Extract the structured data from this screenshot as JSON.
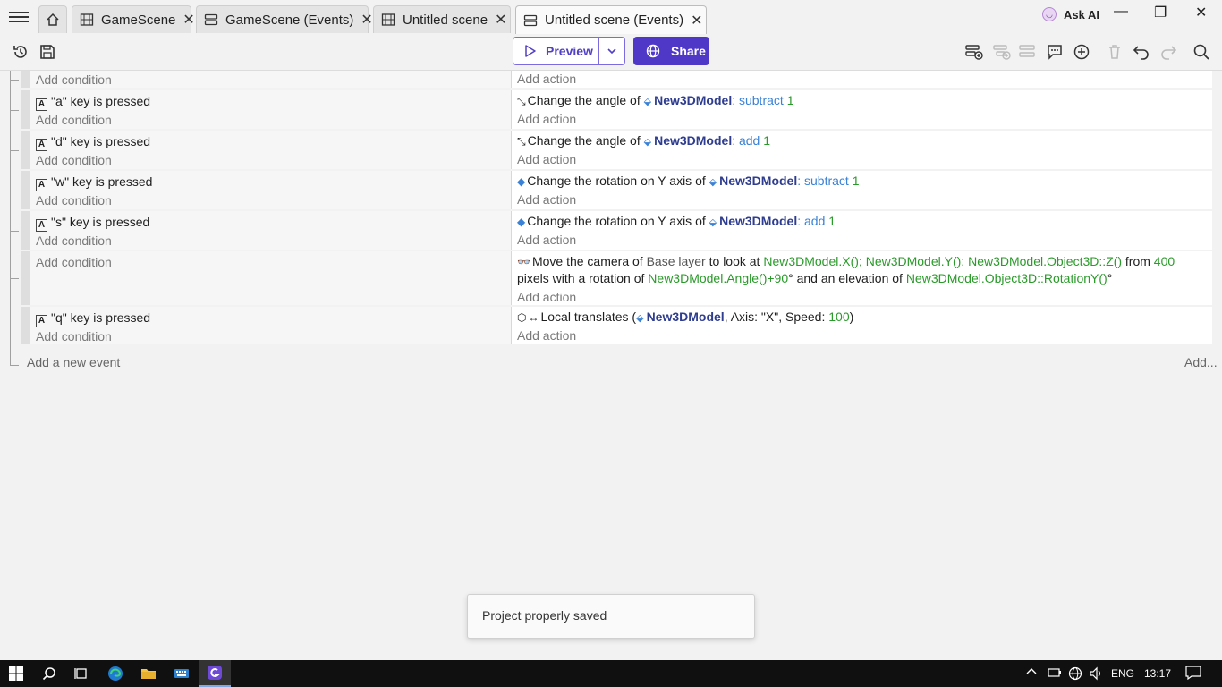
{
  "tabs": [
    {
      "label": "",
      "icon": "home-icon"
    },
    {
      "label": "GameScene",
      "icon": "film-icon",
      "close": "✕"
    },
    {
      "label": "GameScene (Events)",
      "icon": "events-icon",
      "close": "✕"
    },
    {
      "label": "Untitled scene",
      "icon": "film-icon",
      "close": "✕"
    },
    {
      "label": "Untitled scene (Events)",
      "icon": "events-icon",
      "close": "✕",
      "active": true
    }
  ],
  "header": {
    "ask_ai": "Ask AI",
    "minimize": "—",
    "restore": "❐",
    "close": "✕"
  },
  "toolbar": {
    "preview_label": "Preview",
    "share_label": "Share"
  },
  "events": [
    {
      "conditions": [],
      "cond_add": "Add condition",
      "actions": [],
      "act_add": "Add action"
    },
    {
      "conditions": [
        {
          "key": "A",
          "text": "\"a\" key is pressed"
        }
      ],
      "cond_add": "Add condition",
      "actions": [
        {
          "pre": "Change the angle of ",
          "object": "New3DModel",
          "sep": ": ",
          "op": "subtract",
          "val": "1"
        }
      ],
      "act_add": "Add action"
    },
    {
      "conditions": [
        {
          "key": "A",
          "text": "\"d\" key is pressed"
        }
      ],
      "cond_add": "Add condition",
      "actions": [
        {
          "pre": "Change the angle of ",
          "object": "New3DModel",
          "sep": ": ",
          "op": "add",
          "val": "1"
        }
      ],
      "act_add": "Add action"
    },
    {
      "conditions": [
        {
          "key": "A",
          "text": "\"w\" key is pressed"
        }
      ],
      "cond_add": "Add condition",
      "actions": [
        {
          "pre": "Change the rotation on Y axis of ",
          "object": "New3DModel",
          "sep": ": ",
          "op": "subtract",
          "val": "1"
        }
      ],
      "act_add": "Add action"
    },
    {
      "conditions": [
        {
          "key": "A",
          "text": "\"s\" key is pressed"
        }
      ],
      "cond_add": "Add condition",
      "actions": [
        {
          "pre": "Change the rotation on Y axis of ",
          "object": "New3DModel",
          "sep": ": ",
          "op": "add",
          "val": "1"
        }
      ],
      "act_add": "Add action"
    },
    {
      "conditions": [],
      "cond_add": "Add condition",
      "camera_action": {
        "p1": "Move the camera of ",
        "layer": "Base layer",
        "p2": " to look at ",
        "e1": "New3DModel.X()",
        "s1": "; ",
        "e2": "New3DModel.Y()",
        "s2": "; ",
        "e3": "New3DModel.Object3D::Z()",
        "p3": " from ",
        "dist": "400",
        "p4": "pixels with a rotation of ",
        "e4": "New3DModel.Angle()+90",
        "p5": "° and an elevation of ",
        "e5": "New3DModel.Object3D::RotationY()",
        "p6": "°"
      },
      "act_add": "Add action"
    },
    {
      "conditions": [
        {
          "key": "A",
          "text": "\"q\" key is pressed"
        }
      ],
      "cond_add": "Add condition",
      "translate_action": {
        "pre": "Local translates (",
        "object": "New3DModel",
        "mid": ", Axis: \"X\", Speed: ",
        "val": "100",
        "post": ")"
      },
      "act_add": "Add action"
    }
  ],
  "footer": {
    "add_event": "Add a new event",
    "add_more": "Add..."
  },
  "snackbar": {
    "message": "Project properly saved"
  },
  "taskbar": {
    "lang": "ENG",
    "time": "13:17"
  }
}
